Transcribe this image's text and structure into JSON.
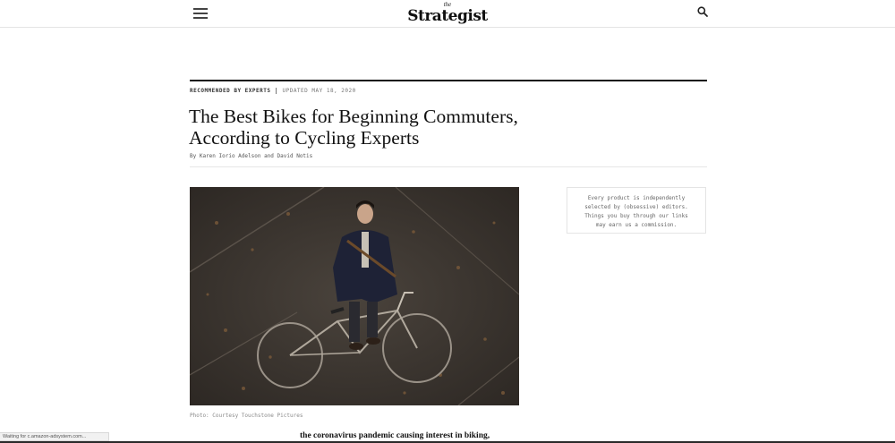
{
  "site": {
    "logo_small": "the",
    "logo_main": "Strategist"
  },
  "icons": {
    "menu": "hamburger-menu-icon",
    "search": "search-icon"
  },
  "article": {
    "tag": "RECOMMENDED BY EXPERTS",
    "date": "UPDATED MAY 18, 2020",
    "headline_line1": "The Best Bikes for Beginning Commuters,",
    "headline_line2": "According to Cycling Experts",
    "byline": "By Karen Iorio Adelson and David Notis",
    "caption": "Photo: Courtesy Touchstone Pictures",
    "body_teaser": "the coronavirus pandemic causing interest in biking,"
  },
  "disclosure": {
    "line1": "Every product is independently",
    "line2": "selected by (obsessive) editors.",
    "line3": "Things you buy through our links",
    "line4": "may earn us a commission."
  },
  "browser": {
    "status": "Waiting for c.amazon-adsystem.com..."
  }
}
